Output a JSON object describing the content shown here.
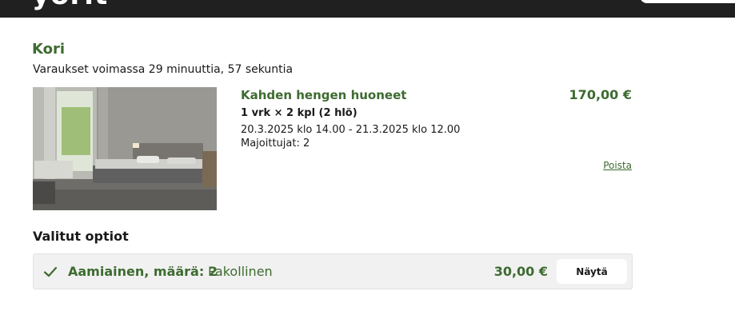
{
  "header": {
    "logo_text": "yorit"
  },
  "cart": {
    "title": "Kori",
    "timer_text": "Varaukset voimassa 29 minuuttia, 57 sekuntia"
  },
  "room": {
    "name": "Kahden hengen huoneet",
    "price": "170,00 €",
    "quantity_text": "1 vrk × 2 kpl (2 hlö)",
    "dates_text": "20.3.2025 klo 14.00 - 21.3.2025 klo 12.00",
    "guests_text": "Majoittujat: 2",
    "remove_label": "Poista"
  },
  "options": {
    "title": "Valitut optiot",
    "items": [
      {
        "name": "Aamiainen, määrä: 2",
        "tag": "Pakollinen",
        "price": "30,00 €",
        "button_label": "Näytä"
      }
    ]
  },
  "colors": {
    "accent": "#3d6b30",
    "header_bg": "#202020",
    "option_bg": "#f1f1f1"
  }
}
